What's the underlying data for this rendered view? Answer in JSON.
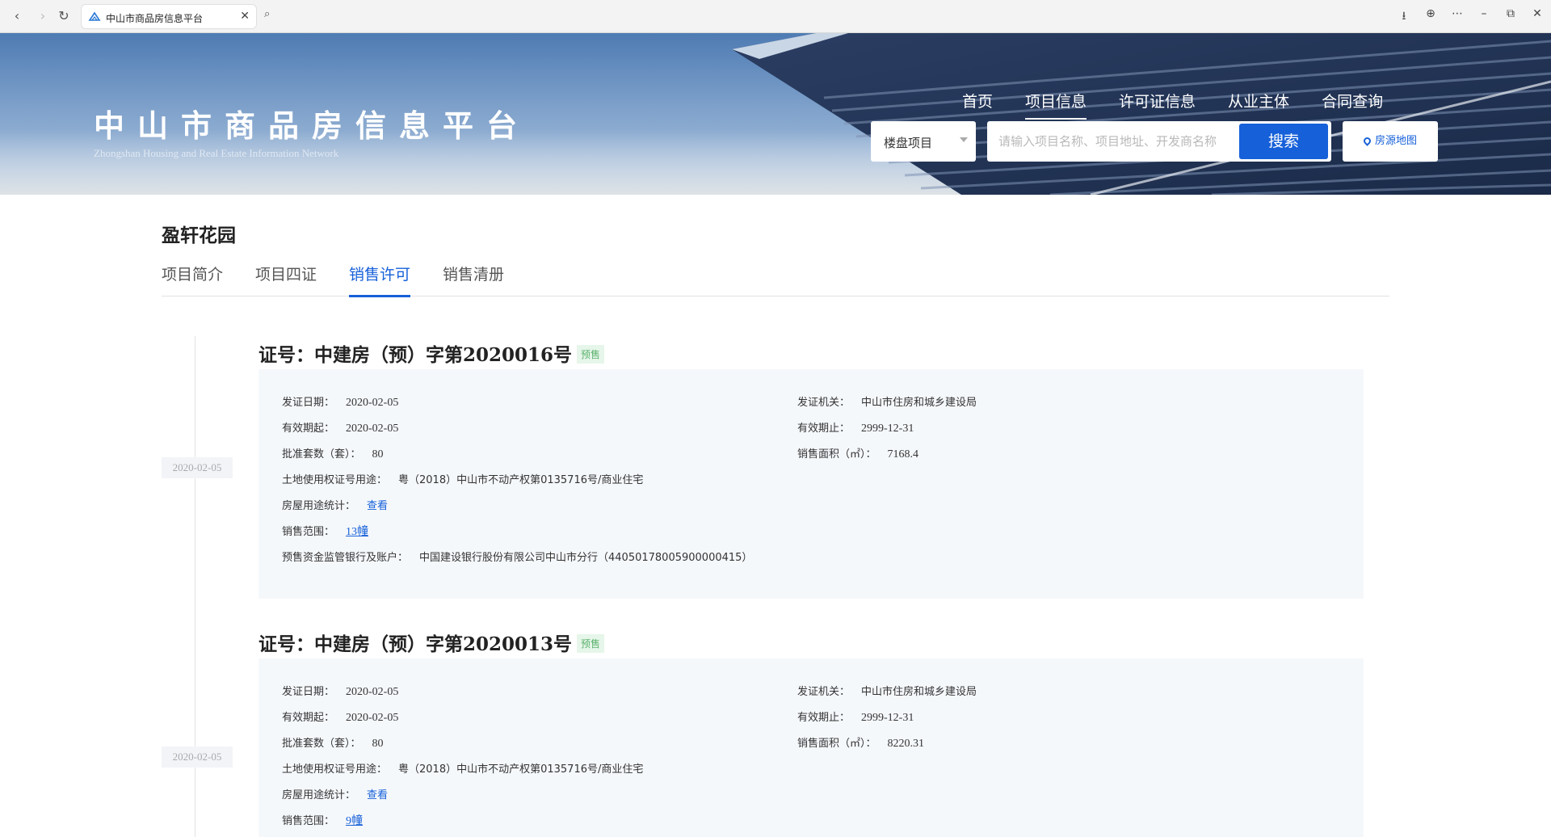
{
  "browser": {
    "tab_title": "中山市商品房信息平台",
    "back_icon": "back-arrow-icon",
    "forward_icon": "forward-arrow-icon",
    "reload_icon": "reload-icon"
  },
  "header": {
    "site_title": "中山市商品房信息平台",
    "site_subtitle": "Zhongshan Housing and Real Estate Information Network",
    "nav": [
      {
        "label": "首页",
        "active": false
      },
      {
        "label": "项目信息",
        "active": true
      },
      {
        "label": "许可证信息",
        "active": false
      },
      {
        "label": "从业主体",
        "active": false
      },
      {
        "label": "合同查询",
        "active": false
      }
    ],
    "search_type": "楼盘项目",
    "search_placeholder": "请输入项目名称、项目地址、开发商名称",
    "search_button": "搜索",
    "map_button": "房源地图"
  },
  "project": {
    "name": "盈轩花园",
    "tabs": [
      {
        "label": "项目简介",
        "active": false
      },
      {
        "label": "项目四证",
        "active": false
      },
      {
        "label": "销售许可",
        "active": true
      },
      {
        "label": "销售清册",
        "active": false
      }
    ]
  },
  "labels": {
    "issue_date": "发证日期：",
    "issuer": "发证机关：",
    "valid_from": "有效期起：",
    "valid_to": "有效期止：",
    "approved_units": "批准套数（套）：",
    "sales_area": "销售面积（㎡）：",
    "land_cert": "土地使用权证号用途：",
    "usage_stats": "房屋用途统计：",
    "sales_scope": "销售范围：",
    "bank_account": "预售资金监管银行及账户："
  },
  "permits": [
    {
      "cert_title": "证号：中建房（预）字第2020016号",
      "tag": "预售",
      "timeline_date": "2020-02-05",
      "issue_date": "2020-02-05",
      "issuer": "中山市住房和城乡建设局",
      "valid_from": "2020-02-05",
      "valid_to": "2999-12-31",
      "approved_units": "80",
      "sales_area": "7168.4",
      "land_cert": "粤（2018）中山市不动产权第0135716号/商业住宅",
      "usage_stats_link": "查看",
      "sales_scope": "13幢",
      "bank_account": "中国建设银行股份有限公司中山市分行（44050178005900000415）"
    },
    {
      "cert_title": "证号：中建房（预）字第2020013号",
      "tag": "预售",
      "timeline_date": "2020-02-05",
      "issue_date": "2020-02-05",
      "issuer": "中山市住房和城乡建设局",
      "valid_from": "2020-02-05",
      "valid_to": "2999-12-31",
      "approved_units": "80",
      "sales_area": "8220.31",
      "land_cert": "粤（2018）中山市不动产权第0135716号/商业住宅",
      "usage_stats_link": "查看",
      "sales_scope": "9幢"
    }
  ]
}
